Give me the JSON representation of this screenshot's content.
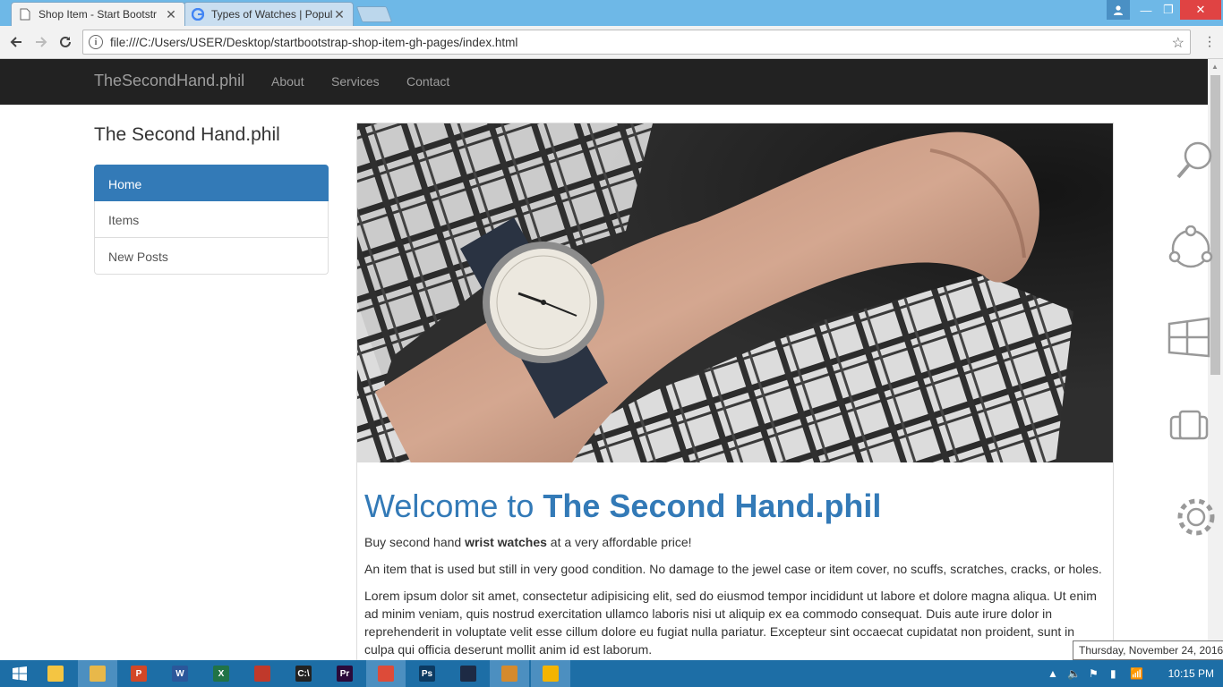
{
  "browser": {
    "tabs": [
      {
        "title": "Shop Item - Start Bootstr",
        "active": true
      },
      {
        "title": "Types of Watches | Popul",
        "active": false
      }
    ],
    "url": "file:///C:/Users/USER/Desktop/startbootstrap-shop-item-gh-pages/index.html"
  },
  "navbar": {
    "brand": "TheSecondHand.phil",
    "links": [
      "About",
      "Services",
      "Contact"
    ]
  },
  "sidebar": {
    "title": "The Second Hand.phil",
    "items": [
      "Home",
      "Items",
      "New Posts"
    ]
  },
  "main": {
    "heading_prefix": "Welcome to ",
    "heading_bold": "The Second Hand.phil",
    "p1_prefix": "Buy second hand ",
    "p1_bold": "wrist watches",
    "p1_suffix": " at a very affordable price!",
    "p2": "An item that is used but still in very good condition. No damage to the jewel case or item cover, no scuffs, scratches, cracks, or holes.",
    "p3": "Lorem ipsum dolor sit amet, consectetur adipisicing elit, sed do eiusmod tempor incididunt ut labore et dolore magna aliqua. Ut enim ad minim veniam, quis nostrud exercitation ullamco laboris nisi ut aliquip ex ea commodo consequat. Duis aute irure dolor in reprehenderit in voluptate velit esse cillum dolore eu fugiat nulla pariatur. Excepteur sint occaecat cupidatat non proident, sunt in culpa qui officia deserunt mollit anim id est laborum."
  },
  "charms": [
    "search-icon",
    "share-icon",
    "start-icon",
    "devices-icon",
    "settings-icon"
  ],
  "taskbar": {
    "time": "10:15 PM",
    "date_tooltip": "Thursday, November 24, 2016",
    "apps": [
      {
        "name": "file-explorer-icon",
        "label": "",
        "color": "#f4c542"
      },
      {
        "name": "folder-icon",
        "label": "",
        "color": "#e8b84a"
      },
      {
        "name": "powerpoint-icon",
        "label": "P",
        "color": "#d24726"
      },
      {
        "name": "word-icon",
        "label": "W",
        "color": "#2b579a"
      },
      {
        "name": "excel-icon",
        "label": "X",
        "color": "#217346"
      },
      {
        "name": "alarm-icon",
        "label": "",
        "color": "#c0392b"
      },
      {
        "name": "cmd-icon",
        "label": "C:\\",
        "color": "#222222"
      },
      {
        "name": "premiere-icon",
        "label": "Pr",
        "color": "#2a0a3a"
      },
      {
        "name": "chrome-icon",
        "label": "",
        "color": "#dd4b39"
      },
      {
        "name": "photoshop-icon",
        "label": "Ps",
        "color": "#0c3a61"
      },
      {
        "name": "app-icon",
        "label": "",
        "color": "#1d2a44"
      },
      {
        "name": "sublime-icon",
        "label": "",
        "color": "#d48a2d"
      },
      {
        "name": "media-player-icon",
        "label": "",
        "color": "#f4b400"
      }
    ]
  },
  "colors": {
    "accent": "#337ab7",
    "navbar": "#222222",
    "taskbar": "#1d6ea6",
    "titlebar": "#6eb8e7"
  }
}
